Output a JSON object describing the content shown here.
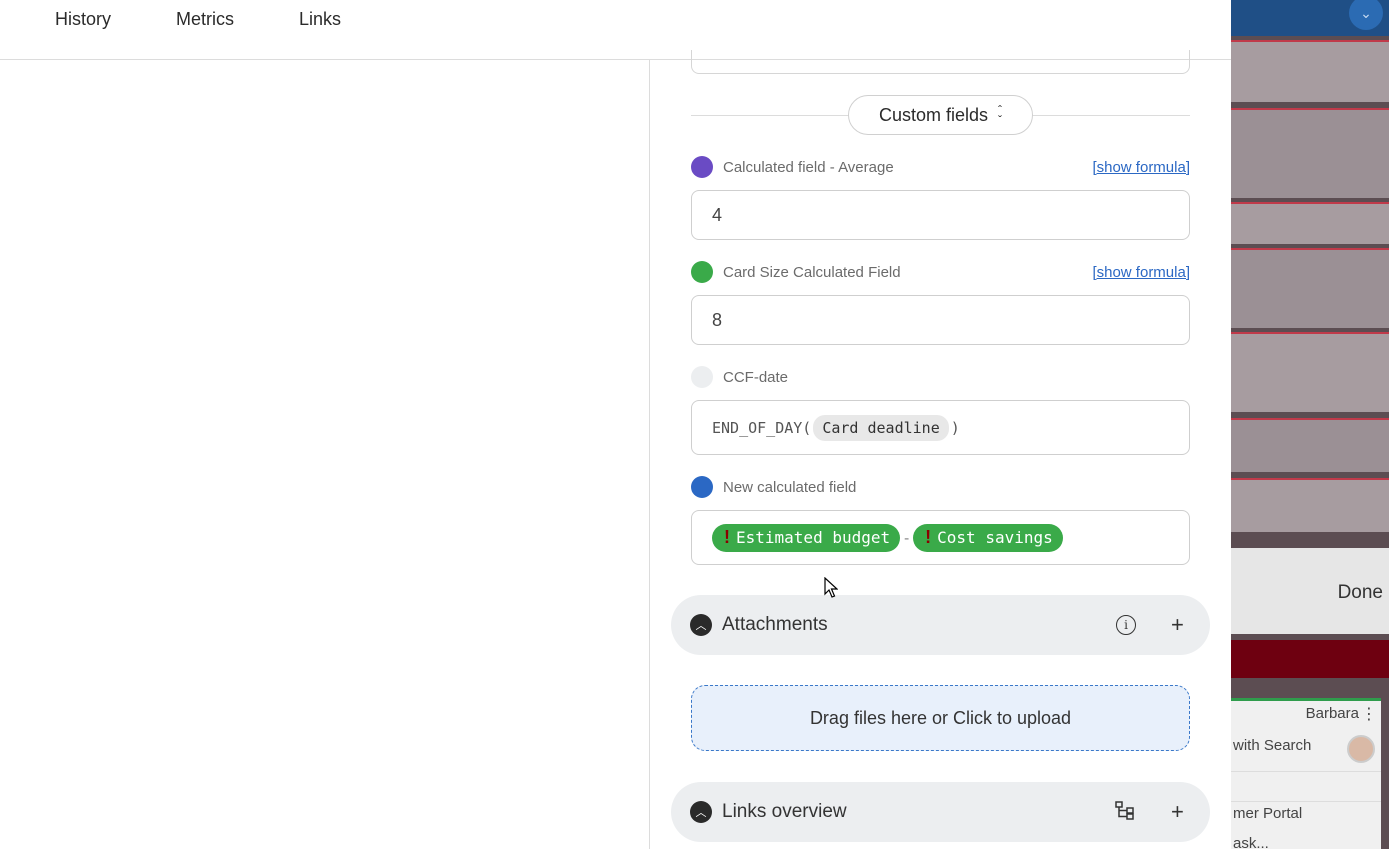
{
  "tabs": [
    {
      "label": "History"
    },
    {
      "label": "Metrics"
    },
    {
      "label": "Links"
    }
  ],
  "custom_fields": {
    "toggle_label": "Custom fields",
    "fields": [
      {
        "label": "Calculated field - Average",
        "link": "[show formula]",
        "value": "4",
        "color": "#6a4bc4"
      },
      {
        "label": "Card Size Calculated Field",
        "link": "[show formula]",
        "value": "8",
        "color": "#3aaa49"
      },
      {
        "label": "CCF-date",
        "color": "#eceef0",
        "formula_fn": "END_OF_DAY(",
        "formula_token": "Card deadline",
        "formula_end": ")"
      },
      {
        "label": "New calculated field",
        "color": "#2b68c4",
        "token1_mark": "!",
        "token1": "Estimated budget",
        "operator": "-",
        "token2_mark": "!",
        "token2": "Cost savings"
      }
    ]
  },
  "attachments": {
    "title": "Attachments",
    "info_icon": "info-icon",
    "add_icon": "plus-icon",
    "upload_text": "Drag files here or Click to upload"
  },
  "links_overview": {
    "title": "Links overview",
    "tree_icon": "hierarchy-icon",
    "add_icon": "plus-icon"
  },
  "background_board": {
    "done_label": "Done",
    "owner": "Barbara",
    "row1": "with Search",
    "row2": "mer Portal",
    "row3": "ask..."
  }
}
